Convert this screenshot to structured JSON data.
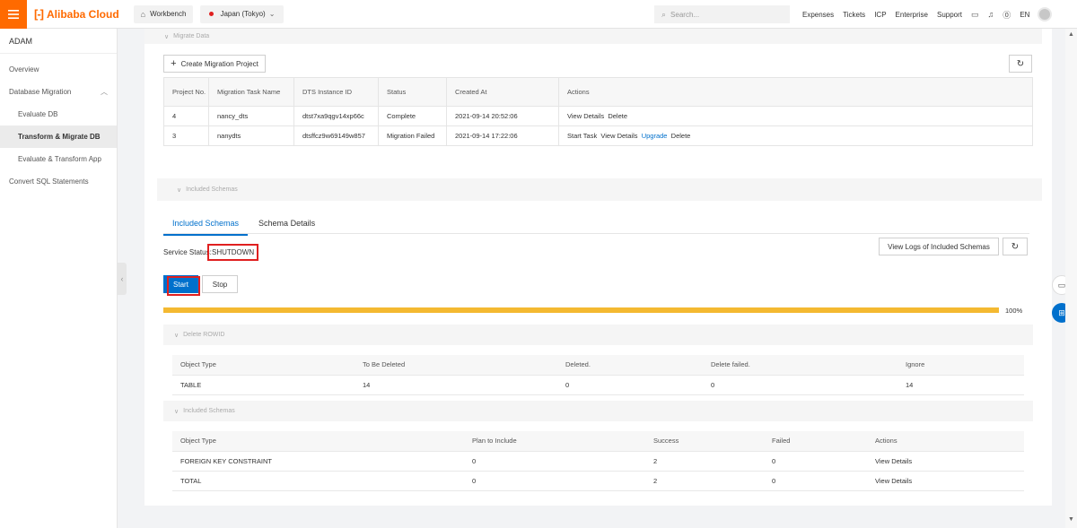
{
  "topbar": {
    "brand": "Alibaba Cloud",
    "workbench": "Workbench",
    "region": "Japan (Tokyo)",
    "search_placeholder": "Search...",
    "links": [
      "Expenses",
      "Tickets",
      "ICP",
      "Enterprise",
      "Support"
    ],
    "language": "EN",
    "accent_color": "#ff6a00"
  },
  "sidebar": {
    "title": "ADAM",
    "items": [
      {
        "label": "Overview"
      },
      {
        "label": "Database Migration"
      },
      {
        "label": "Evaluate DB"
      },
      {
        "label": "Transform & Migrate DB"
      },
      {
        "label": "Evaluate & Transform App"
      },
      {
        "label": "Convert SQL Statements"
      }
    ]
  },
  "migrate": {
    "section_title": "Migrate Data",
    "create_button": "Create Migration Project",
    "columns": [
      "Project No.",
      "Migration Task Name",
      "DTS Instance ID",
      "Status",
      "Created At",
      "Actions"
    ],
    "rows": [
      {
        "no": "4",
        "name": "nancy_dts",
        "instance": "dtst7xa9qgv14xp66c",
        "status": "Complete",
        "created": "2021-09-14 20:52:06",
        "actions": [
          "View Details",
          "Delete"
        ]
      },
      {
        "no": "3",
        "name": "nanydts",
        "instance": "dtsffcz9w69149w857",
        "status": "Migration Failed",
        "created": "2021-09-14 17:22:06",
        "actions": [
          "Start Task",
          "View Details",
          "Upgrade",
          "Delete"
        ]
      }
    ]
  },
  "schemas": {
    "section_title": "Included Schemas",
    "tabs": [
      "Included Schemas",
      "Schema Details"
    ],
    "status_label": "Service Status:",
    "status_value": "SHUTDOWN",
    "view_logs_button": "View Logs of Included Schemas",
    "start_button": "Start",
    "stop_button": "Stop",
    "progress": 100,
    "progress_text": "100%",
    "progress_color": "#f4b931"
  },
  "delete_rowid": {
    "section_title": "Delete ROWID",
    "columns": [
      "Object Type",
      "To Be Deleted",
      "Deleted.",
      "Delete failed.",
      "Ignore"
    ],
    "rows": [
      [
        "TABLE",
        "14",
        "0",
        "0",
        "14"
      ]
    ]
  },
  "included": {
    "section_title": "Included Schemas",
    "columns": [
      "Object Type",
      "Plan to Include",
      "Success",
      "Failed",
      "Actions"
    ],
    "rows": [
      [
        "FOREIGN KEY CONSTRAINT",
        "0",
        "2",
        "0",
        "View Details"
      ],
      [
        "TOTAL",
        "0",
        "2",
        "0",
        "View Details"
      ]
    ]
  }
}
